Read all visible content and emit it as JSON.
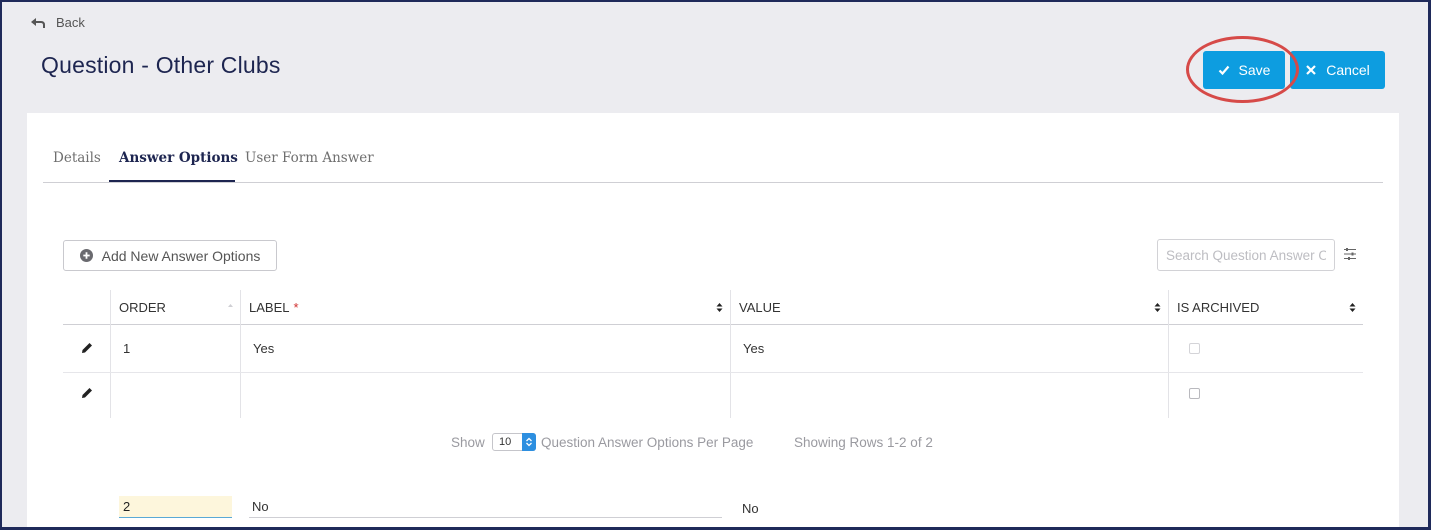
{
  "nav": {
    "back_label": "Back"
  },
  "page": {
    "title": "Question - Other Clubs"
  },
  "actions": {
    "save_label": "Save",
    "cancel_label": "Cancel"
  },
  "tabs": [
    {
      "label": "Details"
    },
    {
      "label": "Answer Options"
    },
    {
      "label": "User Form Answer"
    }
  ],
  "toolbar": {
    "add_label": "Add New Answer Options",
    "search_placeholder": "Search Question Answer Options"
  },
  "table": {
    "columns": [
      {
        "label": "ORDER"
      },
      {
        "label": "LABEL",
        "required_mark": "*"
      },
      {
        "label": "VALUE"
      },
      {
        "label": "IS ARCHIVED"
      }
    ],
    "rows": [
      {
        "order": "1",
        "label": "Yes",
        "value": "Yes",
        "archived": false
      },
      {
        "order": "2",
        "label": "No",
        "value": "No",
        "archived": false
      }
    ]
  },
  "pager": {
    "show_label": "Show",
    "per_page": "10",
    "per_page_label": "Question Answer Options Per Page",
    "summary": "Showing Rows 1-2 of 2"
  },
  "colors": {
    "accent": "#0d9de0",
    "title": "#1d2550",
    "highlight": "#d64a48"
  },
  "icons": {
    "back": "back-arrow-icon",
    "save": "check-icon",
    "cancel": "close-icon",
    "add": "plus-circle-icon",
    "edit": "pencil-icon",
    "filter": "sliders-icon"
  }
}
